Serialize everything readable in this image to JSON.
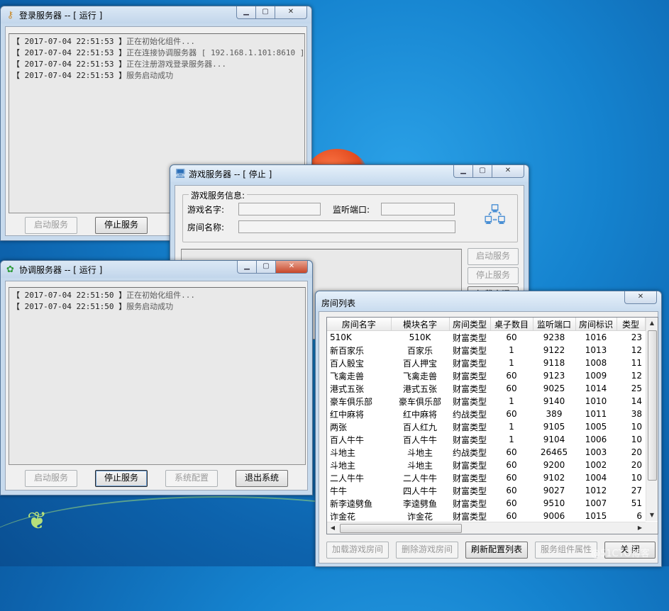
{
  "colors": {
    "desktop_blue": "#1583cf",
    "disabled_text": "#9a9a9a",
    "close_red": "#c7472a"
  },
  "login_window": {
    "title": "登录服务器 -- [ 运行 ]",
    "icon": "key-icon",
    "log": [
      {
        "ts": "【 2017-07-04 22:51:53 】",
        "msg": "正在初始化组件..."
      },
      {
        "ts": "【 2017-07-04 22:51:53 】",
        "msg": "正在连接协调服务器 [ 192.168.1.101:8610 ]"
      },
      {
        "ts": "【 2017-07-04 22:51:53 】",
        "msg": "正在注册游戏登录服务器..."
      },
      {
        "ts": "【 2017-07-04 22:51:53 】",
        "msg": "服务启动成功"
      }
    ],
    "start_label": "启动服务",
    "stop_label": "停止服务"
  },
  "game_window": {
    "title": "游戏服务器 -- [ 停止 ]",
    "icon": "monitor-icon",
    "group_label": "游戏服务信息:",
    "game_name_label": "游戏名字:",
    "port_label": "监听端口:",
    "room_name_label": "房间名称:",
    "start_label": "启动服务",
    "stop_label": "停止服务",
    "load_label": "加载房间"
  },
  "coord_window": {
    "title": "协调服务器 -- [ 运行 ]",
    "icon": "app-icon",
    "log": [
      {
        "ts": "【 2017-07-04 22:51:50 】",
        "msg": "正在初始化组件..."
      },
      {
        "ts": "【 2017-07-04 22:51:50 】",
        "msg": "服务启动成功"
      }
    ],
    "start_label": "启动服务",
    "stop_label": "停止服务",
    "config_label": "系统配置",
    "exit_label": "退出系统"
  },
  "room_list": {
    "title": "房间列表",
    "columns": [
      "房间名字",
      "模块名字",
      "房间类型",
      "桌子数目",
      "监听端口",
      "房间标识",
      "类型"
    ],
    "rows": [
      [
        "510K",
        "510K",
        "财富类型",
        "60",
        "9238",
        "1016",
        "23"
      ],
      [
        "新百家乐",
        "百家乐",
        "财富类型",
        "1",
        "9122",
        "1013",
        "12"
      ],
      [
        "百人骰宝",
        "百人押宝",
        "财富类型",
        "1",
        "9118",
        "1008",
        "11"
      ],
      [
        "飞禽走兽",
        "飞禽走兽",
        "财富类型",
        "60",
        "9123",
        "1009",
        "12"
      ],
      [
        "港式五张",
        "港式五张",
        "财富类型",
        "60",
        "9025",
        "1014",
        "25"
      ],
      [
        "豪车俱乐部",
        "豪车俱乐部",
        "财富类型",
        "1",
        "9140",
        "1010",
        "14"
      ],
      [
        "红中麻将",
        "红中麻将",
        "约战类型",
        "60",
        "389",
        "1011",
        "38"
      ],
      [
        "两张",
        "百人红九",
        "财富类型",
        "1",
        "9105",
        "1005",
        "10"
      ],
      [
        "百人牛牛",
        "百人牛牛",
        "财富类型",
        "1",
        "9104",
        "1006",
        "10"
      ],
      [
        "斗地主",
        "斗地主",
        "约战类型",
        "60",
        "26465",
        "1003",
        "20"
      ],
      [
        "斗地主",
        "斗地主",
        "财富类型",
        "60",
        "9200",
        "1002",
        "20"
      ],
      [
        "二人牛牛",
        "二人牛牛",
        "财富类型",
        "60",
        "9102",
        "1004",
        "10"
      ],
      [
        "牛牛",
        "四人牛牛",
        "财富类型",
        "60",
        "9027",
        "1012",
        "27"
      ],
      [
        "新李逵劈鱼",
        "李逵劈鱼",
        "财富类型",
        "60",
        "9510",
        "1007",
        "51"
      ],
      [
        "诈金花",
        "诈金花",
        "财富类型",
        "60",
        "9006",
        "1015",
        "6"
      ]
    ],
    "load_label": "加载游戏房间",
    "delete_label": "删除游戏房间",
    "refresh_label": "刷新配置列表",
    "props_label": "服务组件属性",
    "close_label": "关 闭"
  },
  "watermark": "@51CTO博客"
}
